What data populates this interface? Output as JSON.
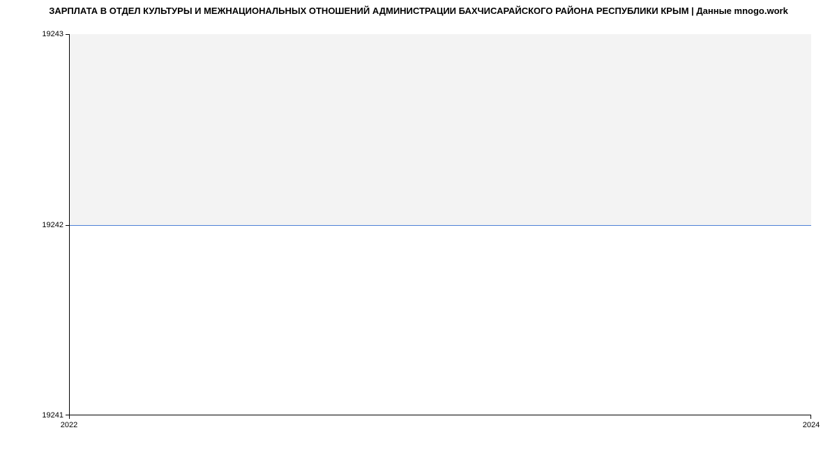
{
  "title": "ЗАРПЛАТА В ОТДЕЛ КУЛЬТУРЫ И МЕЖНАЦИОНАЛЬНЫХ ОТНОШЕНИЙ АДМИНИСТРАЦИИ БАХЧИСАРАЙСКОГО РАЙОНА РЕСПУБЛИКИ КРЫМ | Данные mnogo.work",
  "yticks": {
    "top": "19243",
    "mid": "19242",
    "bot": "19241"
  },
  "xticks": {
    "left": "2022",
    "right": "2024"
  },
  "chart_data": {
    "type": "line",
    "title": "ЗАРПЛАТА В ОТДЕЛ КУЛЬТУРЫ И МЕЖНАЦИОНАЛЬНЫХ ОТНОШЕНИЙ АДМИНИСТРАЦИИ БАХЧИСАРАЙСКОГО РАЙОНА РЕСПУБЛИКИ КРЫМ | Данные mnogo.work",
    "xlabel": "",
    "ylabel": "",
    "x": [
      2022,
      2024
    ],
    "values": [
      19242,
      19242
    ],
    "xlim": [
      2022,
      2024
    ],
    "ylim": [
      19241,
      19243
    ],
    "yticks": [
      19241,
      19242,
      19243
    ],
    "xticks": [
      2022,
      2024
    ],
    "fill_above_line": true,
    "fill_color": "#f3f3f3",
    "line_color": "#4a7fd6"
  }
}
